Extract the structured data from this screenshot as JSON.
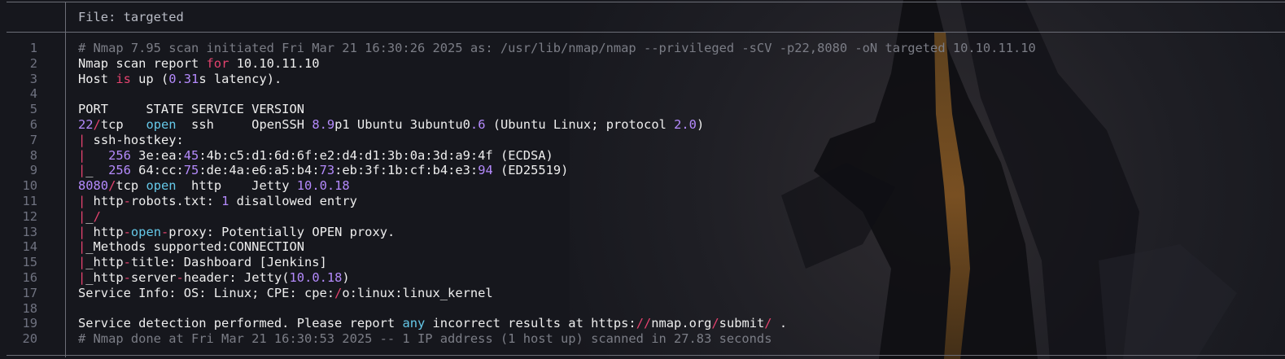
{
  "header": {
    "title": "File: targeted"
  },
  "colors": {
    "background": "#16171d",
    "text": "#eeeeee",
    "comment": "#7b7d86",
    "keyword": "#e5436f",
    "number": "#b48afc",
    "state": "#65c8e8",
    "line_number": "#6f7280",
    "rule": "#6c6e77"
  },
  "lines": [
    {
      "n": "1",
      "segs": [
        {
          "t": "# Nmap 7.95 scan initiated Fri Mar 21 16:30:26 2025 as: /usr/lib/nmap/nmap --privileged -sCV -p22,8080 -oN targeted 10.10.11.10",
          "c": "comment"
        }
      ]
    },
    {
      "n": "2",
      "segs": [
        {
          "t": "Nmap scan report "
        },
        {
          "t": "for",
          "c": "pink"
        },
        {
          "t": " 10.10.11.10"
        }
      ]
    },
    {
      "n": "3",
      "segs": [
        {
          "t": "Host "
        },
        {
          "t": "is",
          "c": "pink"
        },
        {
          "t": " up ("
        },
        {
          "t": "0.31",
          "c": "purple"
        },
        {
          "t": "s latency)."
        }
      ]
    },
    {
      "n": "4",
      "segs": []
    },
    {
      "n": "5",
      "segs": [
        {
          "t": "PORT     STATE SERVICE VERSION"
        }
      ]
    },
    {
      "n": "6",
      "segs": [
        {
          "t": "22",
          "c": "purple"
        },
        {
          "t": "/",
          "c": "pink"
        },
        {
          "t": "tcp   "
        },
        {
          "t": "open",
          "c": "cyan"
        },
        {
          "t": "  ssh     OpenSSH "
        },
        {
          "t": "8.9",
          "c": "purple"
        },
        {
          "t": "p1 Ubuntu 3ubuntu0"
        },
        {
          "t": ".6",
          "c": "purple"
        },
        {
          "t": " (Ubuntu Linux; protocol "
        },
        {
          "t": "2.0",
          "c": "purple"
        },
        {
          "t": ")"
        }
      ]
    },
    {
      "n": "7",
      "segs": [
        {
          "t": "|",
          "c": "pink"
        },
        {
          "t": " ssh-hostkey:"
        }
      ]
    },
    {
      "n": "8",
      "segs": [
        {
          "t": "|",
          "c": "pink"
        },
        {
          "t": "   "
        },
        {
          "t": "256",
          "c": "purple"
        },
        {
          "t": " 3e:ea:"
        },
        {
          "t": "45",
          "c": "purple"
        },
        {
          "t": ":4b:c5:d1:6d:6f:e2:d4:d1:3b:0a:3d:a9:4f (ECDSA)"
        }
      ]
    },
    {
      "n": "9",
      "segs": [
        {
          "t": "|",
          "c": "pink"
        },
        {
          "t": "_  "
        },
        {
          "t": "256",
          "c": "purple"
        },
        {
          "t": " 64:cc:"
        },
        {
          "t": "75",
          "c": "purple"
        },
        {
          "t": ":de:4a:e6:a5:b4:"
        },
        {
          "t": "73",
          "c": "purple"
        },
        {
          "t": ":eb:3f:1b:cf:b4:e3:"
        },
        {
          "t": "94",
          "c": "purple"
        },
        {
          "t": " (ED25519)"
        }
      ]
    },
    {
      "n": "10",
      "segs": [
        {
          "t": "8080",
          "c": "purple"
        },
        {
          "t": "/",
          "c": "pink"
        },
        {
          "t": "tcp "
        },
        {
          "t": "open",
          "c": "cyan"
        },
        {
          "t": "  http    Jetty "
        },
        {
          "t": "10.0.18",
          "c": "purple"
        }
      ]
    },
    {
      "n": "11",
      "segs": [
        {
          "t": "|",
          "c": "pink"
        },
        {
          "t": " http"
        },
        {
          "t": "-",
          "c": "pink"
        },
        {
          "t": "robots.txt: "
        },
        {
          "t": "1",
          "c": "purple"
        },
        {
          "t": " disallowed entry"
        }
      ]
    },
    {
      "n": "12",
      "segs": [
        {
          "t": "|",
          "c": "pink"
        },
        {
          "t": "_"
        },
        {
          "t": "/",
          "c": "pink"
        }
      ]
    },
    {
      "n": "13",
      "segs": [
        {
          "t": "|",
          "c": "pink"
        },
        {
          "t": " http"
        },
        {
          "t": "-",
          "c": "pink"
        },
        {
          "t": "open",
          "c": "cyan"
        },
        {
          "t": "-",
          "c": "pink"
        },
        {
          "t": "proxy: Potentially OPEN proxy."
        }
      ]
    },
    {
      "n": "14",
      "segs": [
        {
          "t": "|",
          "c": "pink"
        },
        {
          "t": "_Methods supported:CONNECTION"
        }
      ]
    },
    {
      "n": "15",
      "segs": [
        {
          "t": "|",
          "c": "pink"
        },
        {
          "t": "_http"
        },
        {
          "t": "-",
          "c": "pink"
        },
        {
          "t": "title: Dashboard [Jenkins]"
        }
      ]
    },
    {
      "n": "16",
      "segs": [
        {
          "t": "|",
          "c": "pink"
        },
        {
          "t": "_http"
        },
        {
          "t": "-",
          "c": "pink"
        },
        {
          "t": "server"
        },
        {
          "t": "-",
          "c": "pink"
        },
        {
          "t": "header: Jetty("
        },
        {
          "t": "10.0.18",
          "c": "purple"
        },
        {
          "t": ")"
        }
      ]
    },
    {
      "n": "17",
      "segs": [
        {
          "t": "Service Info: OS: Linux; CPE: cpe:"
        },
        {
          "t": "/",
          "c": "pink"
        },
        {
          "t": "o:linux:linux_kernel"
        }
      ]
    },
    {
      "n": "18",
      "segs": []
    },
    {
      "n": "19",
      "segs": [
        {
          "t": "Service detection performed. Please report "
        },
        {
          "t": "any",
          "c": "cyan"
        },
        {
          "t": " incorrect results at https:"
        },
        {
          "t": "//",
          "c": "pink"
        },
        {
          "t": "nmap.org"
        },
        {
          "t": "/",
          "c": "pink"
        },
        {
          "t": "submit"
        },
        {
          "t": "/",
          "c": "pink"
        },
        {
          "t": " ."
        }
      ]
    },
    {
      "n": "20",
      "segs": [
        {
          "t": "# Nmap done at Fri Mar 21 16:30:53 2025 -- 1 IP address (1 host up) scanned in 27.83 seconds",
          "c": "comment"
        }
      ]
    }
  ]
}
